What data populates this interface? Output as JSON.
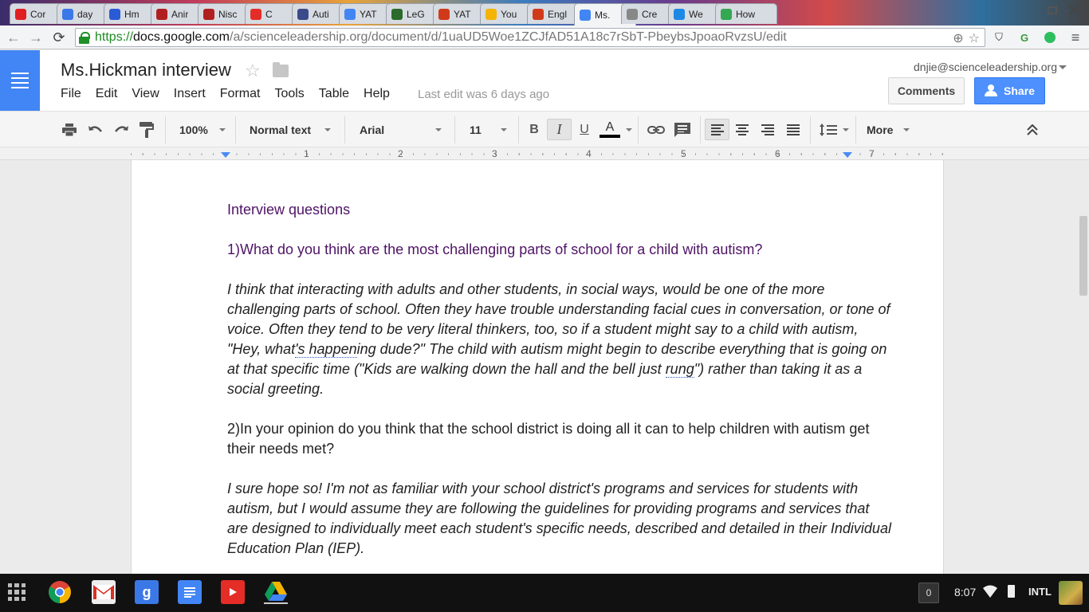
{
  "browser": {
    "tabs": [
      {
        "label": "Cor",
        "fav_color": "#e02020",
        "fav_icon": "circle-icon"
      },
      {
        "label": "day",
        "fav_color": "#3b78e7",
        "fav_icon": "google-icon"
      },
      {
        "label": "Hm",
        "fav_color": "#2a5bd7",
        "fav_icon": "info-icon"
      },
      {
        "label": "Anir",
        "fav_color": "#b02020",
        "fav_icon": "circle-icon"
      },
      {
        "label": "Nisc",
        "fav_color": "#b02020",
        "fav_icon": "circle-icon"
      },
      {
        "label": "C",
        "fav_color": "#e52d27",
        "fav_icon": "youtube-icon"
      },
      {
        "label": "Auti",
        "fav_color": "#3a4a8a",
        "fav_icon": "bookmark-icon"
      },
      {
        "label": "YAT",
        "fav_color": "#4285f4",
        "fav_icon": "docs-icon"
      },
      {
        "label": "LeG",
        "fav_color": "#2a6a2a",
        "fav_icon": "globe-icon"
      },
      {
        "label": "YAT",
        "fav_color": "#d03a1a",
        "fav_icon": "gear-icon"
      },
      {
        "label": "You",
        "fav_color": "#f4b400",
        "fav_icon": "slides-icon"
      },
      {
        "label": "Engl",
        "fav_color": "#d03a1a",
        "fav_icon": "gear-icon"
      },
      {
        "label": "Ms.",
        "fav_color": "#4285f4",
        "fav_icon": "docs-icon",
        "active": true
      },
      {
        "label": "Cre",
        "fav_color": "#888888",
        "fav_icon": "pen-icon"
      },
      {
        "label": "We",
        "fav_color": "#1e88e5",
        "fav_icon": "code-icon"
      },
      {
        "label": "How",
        "fav_color": "#34a853",
        "fav_icon": "chrome-icon"
      }
    ],
    "url": {
      "scheme": "https://",
      "host": "docs.google.com",
      "path": "/a/scienceleadership.org/document/d/1uaUD5Woe1ZCJfAD51A18c7rSbT-PbeybsJpoaoRvzsU/edit"
    },
    "omnibox_icons": [
      "zoom-icon",
      "star-icon"
    ],
    "extension_icons": [
      "shield-icon",
      "extension-icon",
      "evernote-icon",
      "menu-icon"
    ]
  },
  "docs": {
    "title": "Ms.Hickman interview",
    "menus": [
      "File",
      "Edit",
      "View",
      "Insert",
      "Format",
      "Tools",
      "Table",
      "Help"
    ],
    "last_edit": "Last edit was 6 days ago",
    "account": "dnjie@scienceleadership.org",
    "comments_label": "Comments",
    "share_label": "Share"
  },
  "toolbar": {
    "zoom": "100%",
    "style": "Normal text",
    "font": "Arial",
    "size": "11",
    "bold": "B",
    "italic": "I",
    "underline": "U",
    "text_color": "A",
    "more": "More",
    "colors": {
      "text_color_bar": "#000000"
    }
  },
  "ruler": {
    "numbers": [
      "1",
      "2",
      "3",
      "4",
      "5",
      "6",
      "7"
    ]
  },
  "document": {
    "heading": "Interview questions",
    "q1": "1)What do you think are the most challenging parts of school for a child with autism?",
    "a1_part1": "I think that interacting with adults and other students, in social ways, would be one of the more challenging parts of school. Often they have trouble understanding facial cues in conversation, or tone of voice. Often they tend to be very literal thinkers, too, so if a student might say to a child with autism, \"Hey, what",
    "a1_spell1": "'s happen",
    "a1_part2": "ing dude?\" The child with autism might begin to describe everything that is going on at that specific time (\"Kids are walking down the hall and the bell just ",
    "a1_spell2": "rung",
    "a1_part3": "\") rather than taking it as a social greeting.",
    "q2": "2)In your opinion do you think that the school district is doing all it can to help children with autism get their needs met?",
    "a2": "I sure hope so! I'm not as familiar with your school district's programs and services for students with autism, but I would assume they are following the guidelines for providing programs and services that are designed to individually meet each student's specific needs, described and detailed in their Individual Education Plan (IEP).",
    "colors": {
      "question_purple": "#4f1366"
    }
  },
  "shelf": {
    "apps": [
      {
        "name": "chrome",
        "color": "#34a853"
      },
      {
        "name": "gmail",
        "color": "#d93025"
      },
      {
        "name": "google-search",
        "color": "#3b78e7"
      },
      {
        "name": "docs",
        "color": "#4285f4"
      },
      {
        "name": "youtube",
        "color": "#e52d27"
      },
      {
        "name": "drive",
        "color": "#0f9d58"
      }
    ],
    "notification_count": "0",
    "clock": "8:07",
    "ime": "INTL"
  }
}
